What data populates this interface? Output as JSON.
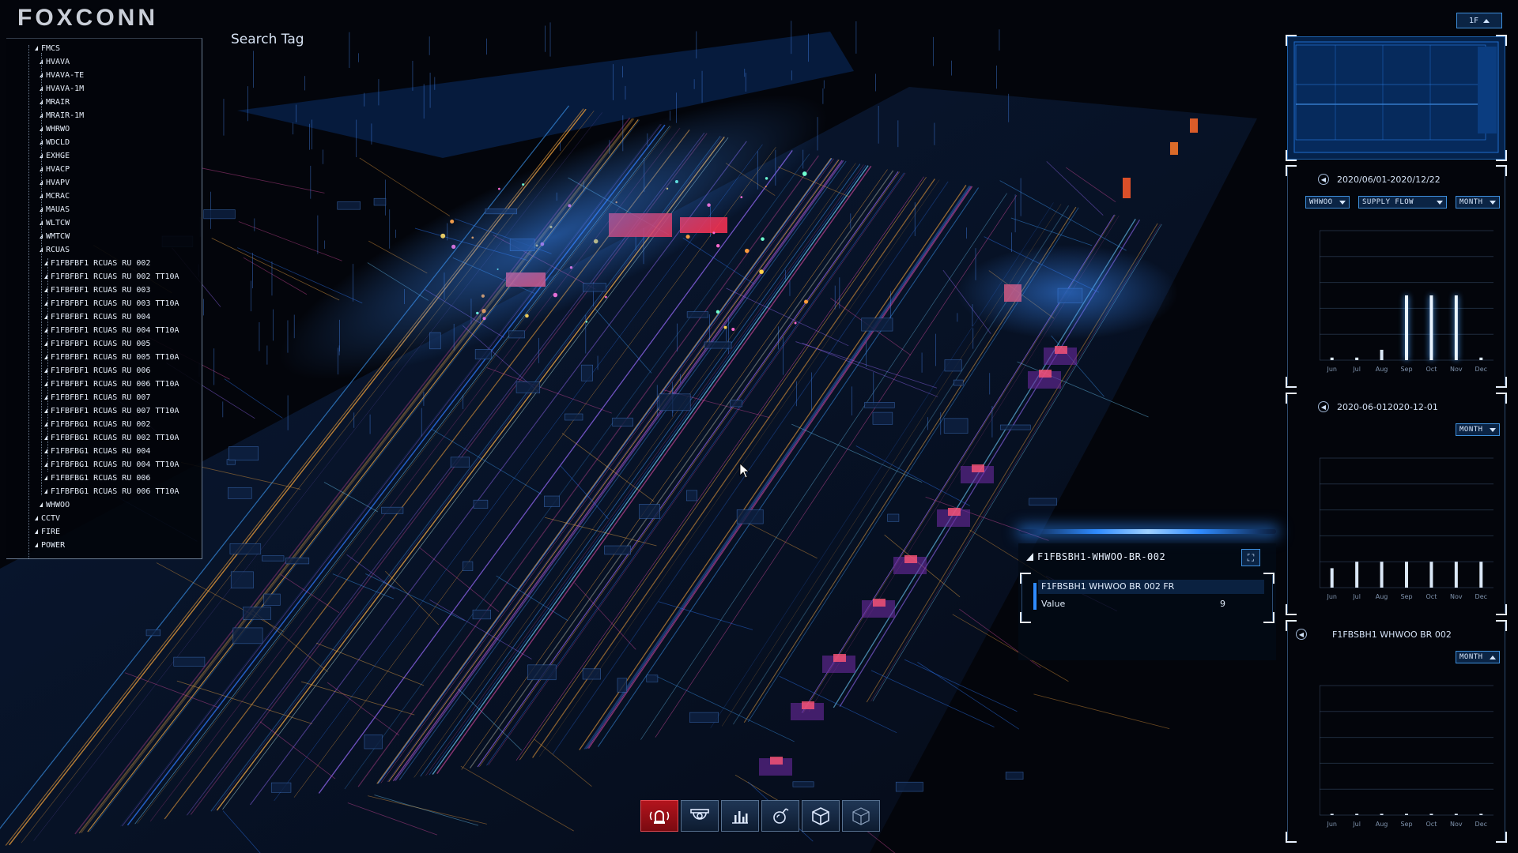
{
  "brand": {
    "logo_text": "FOXCONN"
  },
  "floor_select": {
    "value": "1F"
  },
  "search": {
    "label": "Search Tag"
  },
  "tree": {
    "items": [
      {
        "label": "FMCS",
        "level": 0,
        "y": 0
      },
      {
        "label": "HVAVA",
        "level": 1
      },
      {
        "label": "HVAVA-TE",
        "level": 1
      },
      {
        "label": "HVAVA-1M",
        "level": 1
      },
      {
        "label": "MRAIR",
        "level": 1
      },
      {
        "label": "MRAIR-1M",
        "level": 1
      },
      {
        "label": "WHRWO",
        "level": 1
      },
      {
        "label": "WDCLD",
        "level": 1
      },
      {
        "label": "EXHGE",
        "level": 1
      },
      {
        "label": "HVACP",
        "level": 1
      },
      {
        "label": "HVAPV",
        "level": 1
      },
      {
        "label": "MCRAC",
        "level": 1
      },
      {
        "label": "MAUAS",
        "level": 1
      },
      {
        "label": "WLTCW",
        "level": 1
      },
      {
        "label": "WMTCW",
        "level": 1
      },
      {
        "label": "RCUAS",
        "level": 1
      },
      {
        "label": "F1FBFBF1 RCUAS RU 002",
        "level": 2
      },
      {
        "label": "F1FBFBF1 RCUAS RU 002 TT10A",
        "level": 2
      },
      {
        "label": "F1FBFBF1 RCUAS RU 003",
        "level": 2
      },
      {
        "label": "F1FBFBF1 RCUAS RU 003 TT10A",
        "level": 2
      },
      {
        "label": "F1FBFBF1 RCUAS RU 004",
        "level": 2
      },
      {
        "label": "F1FBFBF1 RCUAS RU 004 TT10A",
        "level": 2
      },
      {
        "label": "F1FBFBF1 RCUAS RU 005",
        "level": 2
      },
      {
        "label": "F1FBFBF1 RCUAS RU 005 TT10A",
        "level": 2
      },
      {
        "label": "F1FBFBF1 RCUAS RU 006",
        "level": 2
      },
      {
        "label": "F1FBFBF1 RCUAS RU 006 TT10A",
        "level": 2
      },
      {
        "label": "F1FBFBF1 RCUAS RU 007",
        "level": 2
      },
      {
        "label": "F1FBFBF1 RCUAS RU 007 TT10A",
        "level": 2
      },
      {
        "label": "F1FBFBG1 RCUAS RU 002",
        "level": 2
      },
      {
        "label": "F1FBFBG1 RCUAS RU 002 TT10A",
        "level": 2
      },
      {
        "label": "F1FBFBG1 RCUAS RU 004",
        "level": 2
      },
      {
        "label": "F1FBFBG1 RCUAS RU 004 TT10A",
        "level": 2
      },
      {
        "label": "F1FBFBG1 RCUAS RU 006",
        "level": 2
      },
      {
        "label": "F1FBFBG1 RCUAS RU 006 TT10A",
        "level": 2
      },
      {
        "label": "WHWOO",
        "level": 1
      },
      {
        "label": "CCTV",
        "level": 0
      },
      {
        "label": "FIRE",
        "level": 0
      },
      {
        "label": "POWER",
        "level": 0
      }
    ]
  },
  "panels": {
    "chart1": {
      "date_range": "2020/06/01-2020/12/22",
      "dropdowns": [
        "WHWOO",
        "SUPPLY FLOW",
        "MONTH"
      ],
      "months": [
        "Jun",
        "Jul",
        "Aug",
        "Sep",
        "Oct",
        "Nov",
        "Dec"
      ],
      "values": [
        0.02,
        0.02,
        0.08,
        0.5,
        0.5,
        0.5,
        0.02
      ]
    },
    "chart2": {
      "date_range": "2020-06-012020-12-01",
      "dropdowns": [
        "MONTH"
      ],
      "months": [
        "Jun",
        "Jul",
        "Aug",
        "Sep",
        "Oct",
        "Nov",
        "Dec"
      ],
      "values": [
        0.15,
        0.2,
        0.2,
        0.2,
        0.2,
        0.2,
        0.2
      ]
    },
    "chart3": {
      "title": "F1FBSBH1 WHWOO BR 002",
      "dropdowns": [
        "MONTH"
      ],
      "months": [
        "Jun",
        "Jul",
        "Aug",
        "Sep",
        "Oct",
        "Nov",
        "Dec"
      ],
      "values": [
        0.01,
        0.01,
        0.01,
        0.01,
        0.01,
        0.01,
        0.01
      ]
    }
  },
  "info": {
    "title": "F1FBSBH1-WHWOO-BR-002",
    "tag": "F1FBSBH1 WHWOO BR 002 FR",
    "value_label": "Value",
    "value": "9"
  },
  "toolbar": {
    "tools": [
      "alarm-icon",
      "cctv-icon",
      "chart-icon",
      "fire-icon",
      "cube-icon",
      "cube-outline-icon"
    ],
    "active": "alarm-icon"
  },
  "colors": {
    "accent": "#2f8bff",
    "alarm": "#c0141d",
    "panel_bg": "#03050b"
  }
}
